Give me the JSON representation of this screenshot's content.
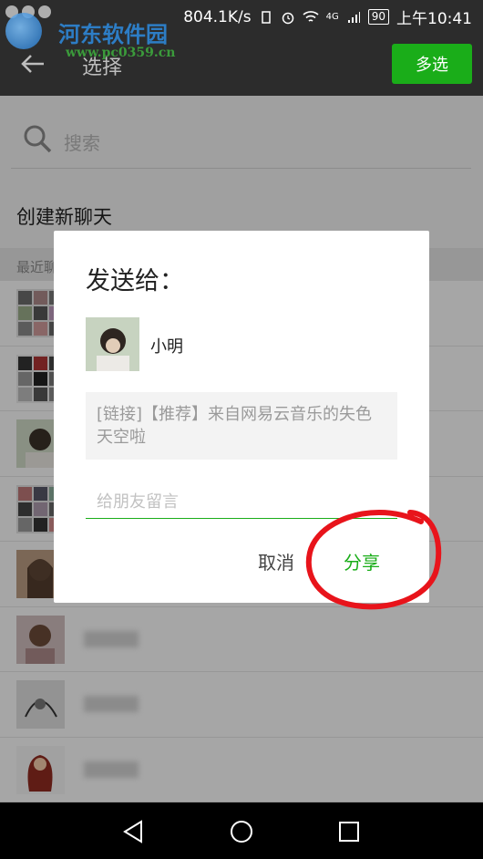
{
  "status_bar": {
    "speed": "804.1K/s",
    "network": "4G",
    "battery": "90",
    "time": "上午10:41"
  },
  "watermark": {
    "title": "河东软件园",
    "url": "www.pc0359.cn"
  },
  "header": {
    "title": "选择",
    "multi_select_label": "多选"
  },
  "search": {
    "placeholder": "搜索"
  },
  "new_chat_label": "创建新聊天",
  "recent_section_label": "最近聊",
  "contacts": [
    {
      "avatar": "collage-avatar"
    },
    {
      "avatar": "grid-avatar"
    },
    {
      "avatar": "person-avatar"
    },
    {
      "avatar": "collage-avatar"
    },
    {
      "avatar": "girl-avatar"
    },
    {
      "avatar": "person-avatar"
    },
    {
      "avatar": "sketch-avatar"
    },
    {
      "avatar": "redhair-avatar"
    }
  ],
  "dialog": {
    "title": "发送给：",
    "recipient_name": "小明",
    "preview_text": "[链接]【推荐】来自网易云音乐的失色天空啦",
    "message_placeholder": "给朋友留言",
    "cancel_label": "取消",
    "share_label": "分享"
  },
  "colors": {
    "accent": "#1aad19",
    "annotation": "#e8141b"
  }
}
